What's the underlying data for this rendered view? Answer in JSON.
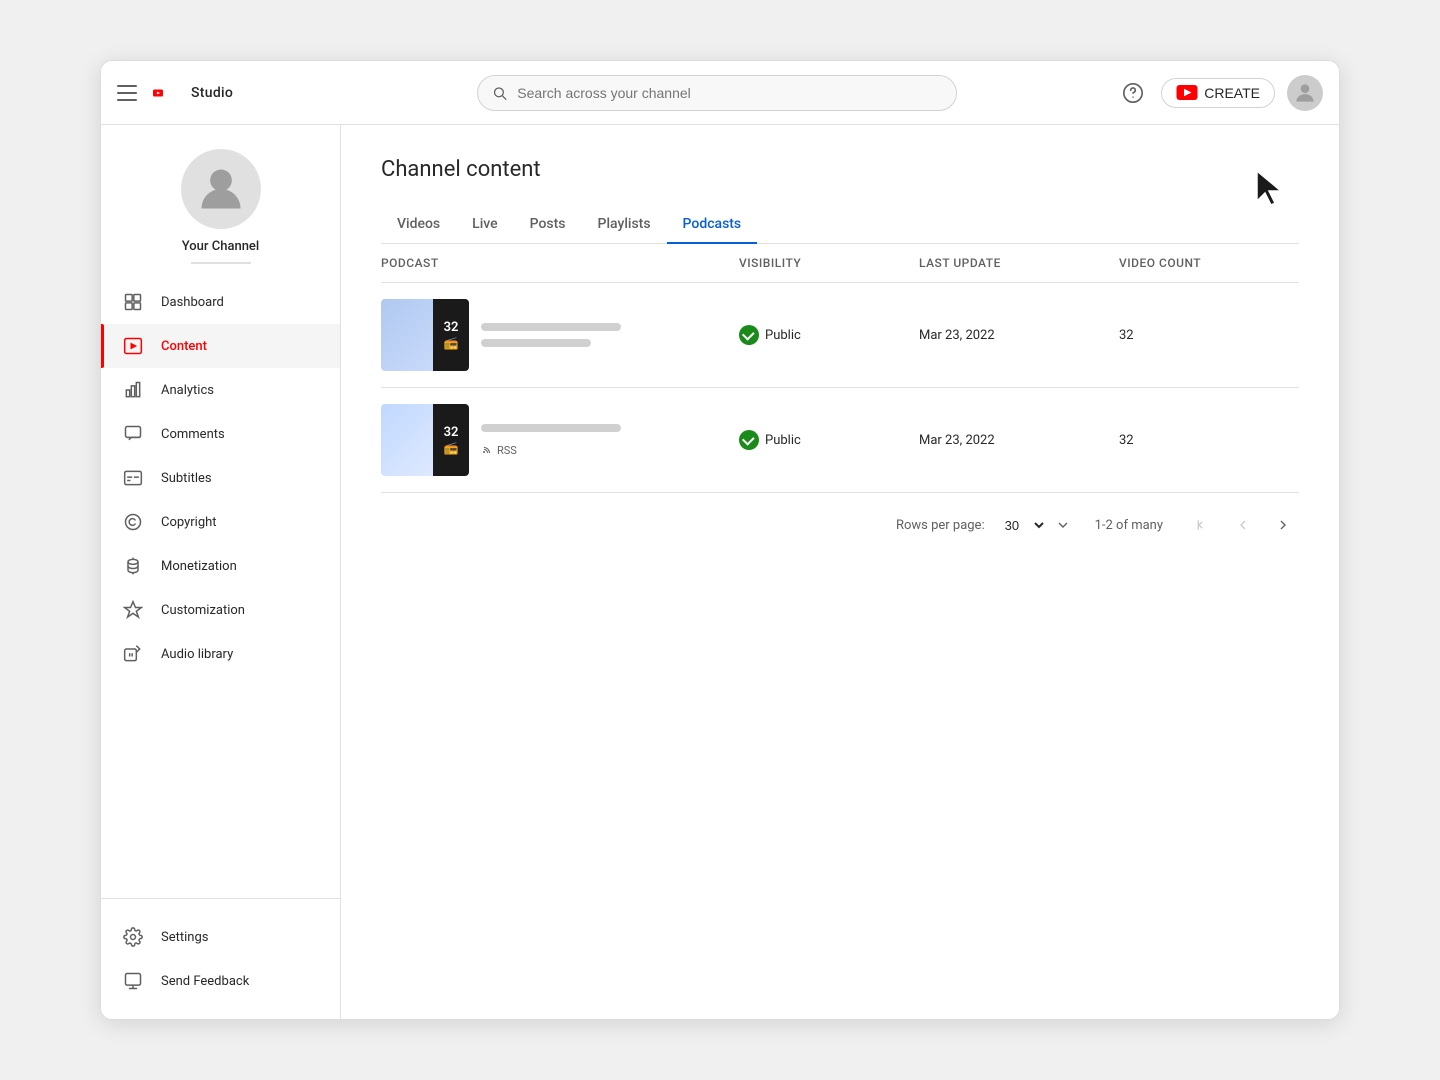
{
  "app": {
    "title": "YouTube Studio",
    "logo_text": "Studio"
  },
  "topbar": {
    "search_placeholder": "Search across your channel",
    "create_label": "CREATE",
    "help_icon": "?",
    "hamburger": "menu"
  },
  "sidebar": {
    "channel_name": "Your Channel",
    "nav_items": [
      {
        "id": "dashboard",
        "label": "Dashboard",
        "icon": "grid"
      },
      {
        "id": "content",
        "label": "Content",
        "icon": "play",
        "active": true
      },
      {
        "id": "analytics",
        "label": "Analytics",
        "icon": "bar-chart"
      },
      {
        "id": "comments",
        "label": "Comments",
        "icon": "comment"
      },
      {
        "id": "subtitles",
        "label": "Subtitles",
        "icon": "subtitles"
      },
      {
        "id": "copyright",
        "label": "Copyright",
        "icon": "copyright"
      },
      {
        "id": "monetization",
        "label": "Monetization",
        "icon": "dollar"
      },
      {
        "id": "customization",
        "label": "Customization",
        "icon": "wand"
      },
      {
        "id": "audio-library",
        "label": "Audio library",
        "icon": "music"
      }
    ],
    "bottom_items": [
      {
        "id": "settings",
        "label": "Settings",
        "icon": "gear"
      },
      {
        "id": "send-feedback",
        "label": "Send Feedback",
        "icon": "feedback"
      }
    ]
  },
  "main": {
    "page_title": "Channel content",
    "tabs": [
      {
        "id": "videos",
        "label": "Videos",
        "active": false
      },
      {
        "id": "live",
        "label": "Live",
        "active": false
      },
      {
        "id": "posts",
        "label": "Posts",
        "active": false
      },
      {
        "id": "playlists",
        "label": "Playlists",
        "active": false
      },
      {
        "id": "podcasts",
        "label": "Podcasts",
        "active": true
      }
    ],
    "table": {
      "headers": [
        {
          "id": "podcast",
          "label": "Podcast"
        },
        {
          "id": "visibility",
          "label": "Visibility"
        },
        {
          "id": "last-update",
          "label": "Last update"
        },
        {
          "id": "video-count",
          "label": "Video count"
        }
      ],
      "rows": [
        {
          "id": "row-1",
          "count": "32",
          "visibility": "Public",
          "date": "Mar 23, 2022",
          "video_count": "32",
          "has_rss": false
        },
        {
          "id": "row-2",
          "count": "32",
          "visibility": "Public",
          "date": "Mar 23, 2022",
          "video_count": "32",
          "has_rss": true,
          "rss_label": "RSS"
        }
      ]
    },
    "pagination": {
      "rows_per_page_label": "Rows per page:",
      "rows_per_page": "30",
      "range": "1-2 of many",
      "first_icon": "|<",
      "prev_icon": "<",
      "next_icon": ">"
    }
  }
}
